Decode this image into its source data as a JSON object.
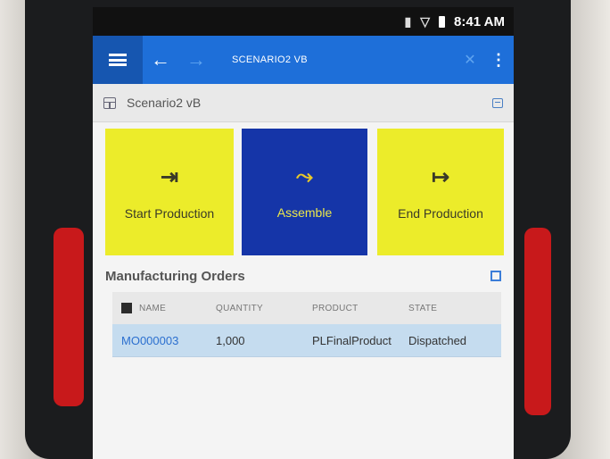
{
  "status_bar": {
    "time": "8:41 AM",
    "icons": [
      "vibrate-icon",
      "wifi-icon",
      "battery-icon"
    ]
  },
  "app_bar": {
    "title": "SCENARIO2 VB",
    "menu_icon": "hamburger-icon",
    "back_icon": "back-arrow-icon",
    "forward_icon": "forward-arrow-icon",
    "close_icon": "close-icon",
    "more_icon": "kebab-menu-icon"
  },
  "view": {
    "title": "Scenario2 vB"
  },
  "tiles": [
    {
      "label": "Start Production",
      "icon": "⇥",
      "icon_name": "start-production-icon",
      "color": "#ecec2a"
    },
    {
      "label": "Assemble",
      "icon": "⤳",
      "icon_name": "assemble-icon",
      "color": "#1535a8"
    },
    {
      "label": "End Production",
      "icon": "↦",
      "icon_name": "end-production-icon",
      "color": "#ecec2a"
    }
  ],
  "orders": {
    "title": "Manufacturing Orders",
    "columns": [
      "NAME",
      "QUANTITY",
      "PRODUCT",
      "STATE"
    ],
    "rows": [
      {
        "name": "MO000003",
        "quantity": "1,000",
        "product": "PLFinalProduct",
        "state": "Dispatched"
      }
    ]
  },
  "colors": {
    "app_bar": "#1e6fd9",
    "tile_yellow": "#ecec2a",
    "tile_blue": "#1535a8",
    "selected_row": "#c5dcef",
    "bumper": "#c8191b"
  }
}
